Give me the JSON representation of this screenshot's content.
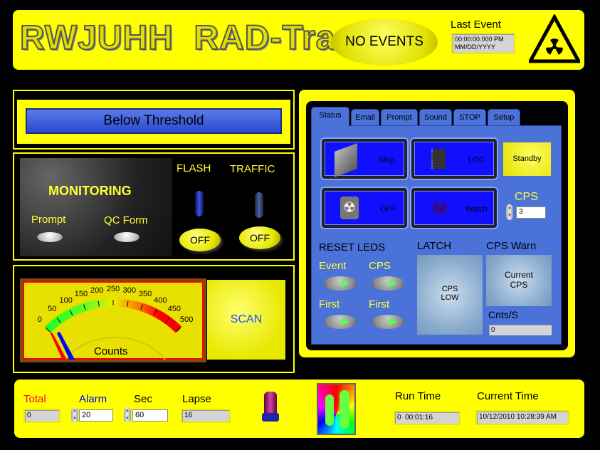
{
  "header": {
    "title": "RWJUHH  RAD-Track",
    "event_status": "NO EVENTS",
    "last_event_label": "Last Event",
    "last_event_time": "00:00:00.000 PM",
    "last_event_date": "MM/DD/YYYY",
    "icon": "radiation-warning-icon"
  },
  "threshold": {
    "label": "Below Threshold"
  },
  "monitoring": {
    "label": "MONITORING",
    "prompt_label": "Prompt",
    "qc_label": "QC Form",
    "flash_label": "FLASH",
    "traffic_label": "TRAFFIC",
    "flash_btn": "OFF",
    "traffic_btn": "OFF"
  },
  "gauge": {
    "label": "Counts",
    "ticks": [
      "0",
      "50",
      "100",
      "150",
      "200",
      "250",
      "300",
      "350",
      "400",
      "450",
      "500"
    ],
    "min": 0,
    "max": 500,
    "value": 0,
    "scan_label": "SCAN"
  },
  "tabs": [
    {
      "label": "Status"
    },
    {
      "label": "Email"
    },
    {
      "label": "Prompt"
    },
    {
      "label": "Sound"
    },
    {
      "label": "STOP"
    },
    {
      "label": "Setup"
    }
  ],
  "status": {
    "ship": "Ship",
    "log": "LOG",
    "off": "OFF",
    "watch": "Watch",
    "standby": "Standby",
    "cps_label": "CPS",
    "cps_value": "3",
    "reset_leds": "RESET LEDS",
    "event": "Event",
    "cps": "CPS",
    "first1": "First",
    "first2": "First",
    "latch": "LATCH",
    "latch_text1": "CPS",
    "latch_text2": "LOW",
    "cps_warn": "CPS Warn",
    "warn_text1": "Current",
    "warn_text2": "CPS",
    "cnts_label": "Cnts/S",
    "cnts_value": "0"
  },
  "footer": {
    "total_label": "Total",
    "total_value": "0",
    "alarm_label": "Alarm",
    "alarm_value": "20",
    "sec_label": "Sec",
    "sec_value": "60",
    "lapse_label": "Lapse",
    "lapse_value": "16",
    "run_time_label": "Run Time",
    "run_time_value": "0  00:01:16",
    "current_time_label": "Current Time",
    "current_time_value": "10/12/2010 10:28:39 AM"
  },
  "colors": {
    "panel": "#ffff00",
    "tab_blue": "#4a72d8",
    "button_blue": "#1010ff",
    "total_red": "#ff0040",
    "alarm_blue": "#0000ff"
  }
}
